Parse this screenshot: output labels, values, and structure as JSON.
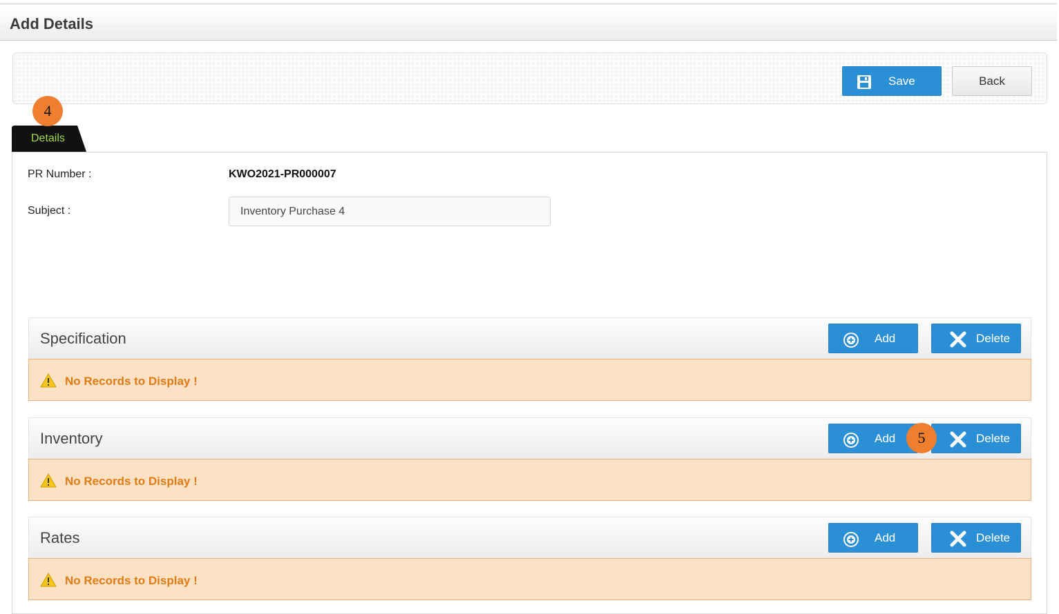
{
  "page": {
    "title": "Add Details"
  },
  "toolbar": {
    "save_label": "Save",
    "back_label": "Back"
  },
  "tabs": [
    {
      "label": "Details",
      "active": true
    }
  ],
  "markers": {
    "tab_marker": "4",
    "add_marker": "5",
    "color": "#ef7e2f"
  },
  "form": {
    "pr_number_label": "PR Number :",
    "pr_number_value": "KWO2021-PR000007",
    "subject_label": "Subject :",
    "subject_value": "Inventory Purchase 4"
  },
  "panels": [
    {
      "title": "Specification",
      "add_label": "Add",
      "delete_label": "Delete",
      "empty_message": "No Records to Display !"
    },
    {
      "title": "Inventory",
      "add_label": "Add",
      "delete_label": "Delete",
      "empty_message": "No Records to Display !"
    },
    {
      "title": "Rates",
      "add_label": "Add",
      "delete_label": "Delete",
      "empty_message": "No Records to Display !"
    }
  ],
  "icons": {
    "save": "floppy-disk-icon",
    "add": "plus-circle-icon",
    "delete": "x-icon",
    "warning": "warning-triangle-icon"
  },
  "colors": {
    "primary_button": "#2b8fd6",
    "alert_background": "#fde1c4",
    "alert_text": "#e07b14",
    "tab_background": "#111111",
    "tab_text": "#a6d94a"
  }
}
